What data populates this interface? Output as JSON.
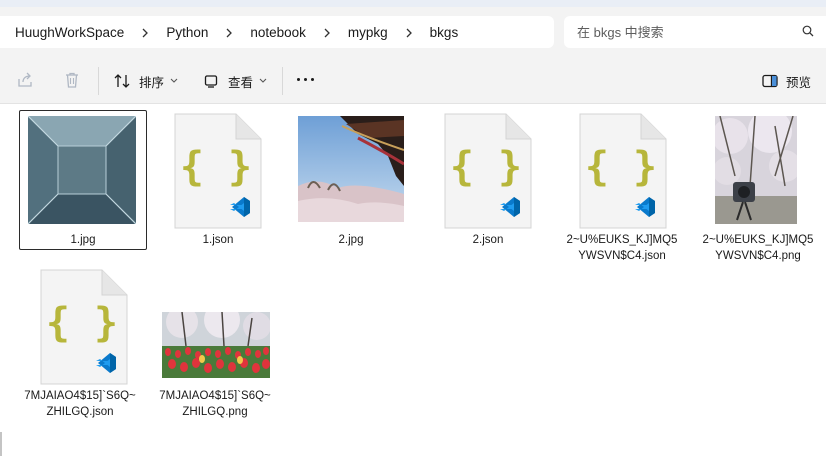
{
  "breadcrumb": {
    "items": [
      "HuughWorkSpace",
      "Python",
      "notebook",
      "mypkg",
      "bkgs"
    ]
  },
  "search": {
    "placeholder": "在 bkgs 中搜索"
  },
  "toolbar": {
    "sort_label": "排序",
    "view_label": "查看",
    "preview_label": "预览"
  },
  "files": [
    {
      "name": "1.jpg",
      "type": "image",
      "selected": true
    },
    {
      "name": "1.json",
      "type": "json"
    },
    {
      "name": "2.jpg",
      "type": "image"
    },
    {
      "name": "2.json",
      "type": "json"
    },
    {
      "name": "2~U%EUKS_KJ]MQ5YWSVN$C4.json",
      "type": "json"
    },
    {
      "name": "2~U%EUKS_KJ]MQ5YWSVN$C4.png",
      "type": "image"
    },
    {
      "name": "7MJAIAO4$15]`S6Q~ZHILGQ.json",
      "type": "json"
    },
    {
      "name": "7MJAIAO4$15]`S6Q~ZHILGQ.png",
      "type": "image"
    }
  ],
  "colors": {
    "json_brace": "#b7b63b",
    "vscode_blue": "#0a7acc",
    "selection_border": "#2b2b2b"
  }
}
